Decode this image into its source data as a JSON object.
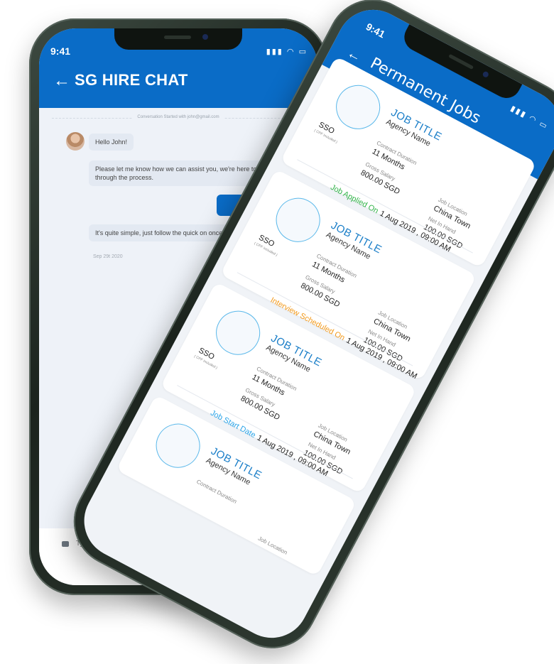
{
  "chat": {
    "status_time": "9:41",
    "title": "SG HIRE CHAT",
    "conversation_started": "Conversation Started with john@gmail.com",
    "messages": [
      "Hello John!",
      "Please let me know how we can assist you, we're here to guide you through the process.",
      "It's quite simple, just follow the quick on once you've have signed up."
    ],
    "date": "Sep 29t 2020",
    "input_placeholder": "Type a message"
  },
  "jobs": {
    "status_time": "9:41",
    "title": "Permanent Jobs",
    "cards": [
      {
        "job_title": "JOB TITLE",
        "agency": "Agency Name",
        "sso": "SSO",
        "cpf": "( CPF Included )",
        "contract_label": "Contract Duration",
        "contract_value": "11 Months",
        "gross_label": "Gross Salary",
        "gross_value": "800.00 SGD",
        "location_label": "Job Location",
        "location_value": "China Town",
        "net_label": "Net In Hand",
        "net_value": "100.00 SGD",
        "status_label": "Job Applied On",
        "status_date": "1 Aug 2019 , 09:00 AM"
      },
      {
        "job_title": "JOB TITLE",
        "agency": "Agency Name",
        "sso": "SSO",
        "cpf": "( CPF Included )",
        "contract_label": "Contract Duration",
        "contract_value": "11 Months",
        "gross_label": "Gross Salary",
        "gross_value": "800.00 SGD",
        "location_label": "Job Location",
        "location_value": "China Town",
        "net_label": "Net In Hand",
        "net_value": "100.00 SGD",
        "status_label": "Interview Scheduled On",
        "status_date": "1 Aug 2019 , 09:00 AM"
      },
      {
        "job_title": "JOB TITLE",
        "agency": "Agency Name",
        "sso": "SSO",
        "cpf": "( CPF Included )",
        "contract_label": "Contract Duration",
        "contract_value": "11 Months",
        "gross_label": "Gross Salary",
        "gross_value": "800.00 SGD",
        "location_label": "Job Location",
        "location_value": "China Town",
        "net_label": "Net In Hand",
        "net_value": "100.00 SGD",
        "status_label": "Job Start Date",
        "status_date": "1 Aug 2019 , 09:00 AM"
      },
      {
        "job_title": "JOB TITLE",
        "agency": "Agency Name",
        "contract_label": "Contract Duration",
        "location_label": "Job Location"
      }
    ]
  },
  "colors": {
    "brand_blue": "#0a6cc7",
    "applied_green": "#32b34a",
    "interview_orange": "#f39a1c",
    "start_blue": "#2ba4e8"
  },
  "icons": [
    "back-arrow-icon",
    "signal-icon",
    "wifi-icon",
    "battery-icon",
    "message-icon"
  ]
}
